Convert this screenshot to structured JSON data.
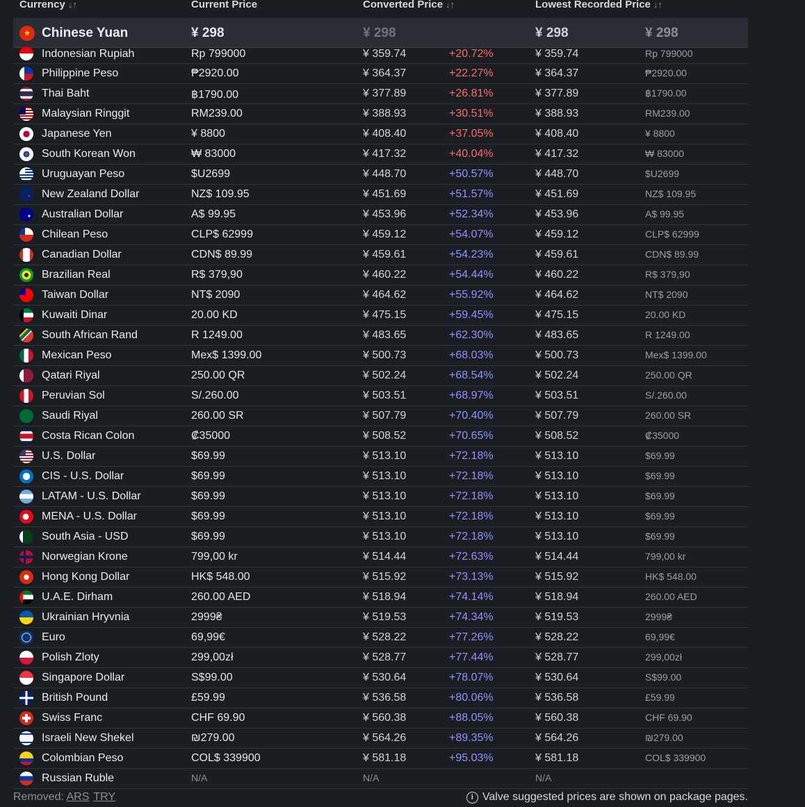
{
  "headers": {
    "currency": "Currency",
    "current_price": "Current Price",
    "converted_price": "Converted Price",
    "lowest_recorded_price": "Lowest Recorded Price",
    "sort_glyph": "↓↑"
  },
  "base": {
    "name": "Chinese Yuan",
    "current": "¥ 298",
    "converted": "¥ 298",
    "lowest": "¥ 298",
    "lowest_local": "¥ 298"
  },
  "rows": [
    {
      "name": "Indonesian Rupiah",
      "current": "Rp 799000",
      "converted": "¥ 359.74",
      "pct": "+20.72%",
      "lowest": "¥ 359.74",
      "lowest_local": "Rp 799000"
    },
    {
      "name": "Philippine Peso",
      "current": "₱2920.00",
      "converted": "¥ 364.37",
      "pct": "+22.27%",
      "lowest": "¥ 364.37",
      "lowest_local": "₱2920.00"
    },
    {
      "name": "Thai Baht",
      "current": "฿1790.00",
      "converted": "¥ 377.89",
      "pct": "+26.81%",
      "lowest": "¥ 377.89",
      "lowest_local": "฿1790.00"
    },
    {
      "name": "Malaysian Ringgit",
      "current": "RM239.00",
      "converted": "¥ 388.93",
      "pct": "+30.51%",
      "lowest": "¥ 388.93",
      "lowest_local": "RM239.00"
    },
    {
      "name": "Japanese Yen",
      "current": "¥ 8800",
      "converted": "¥ 408.40",
      "pct": "+37.05%",
      "lowest": "¥ 408.40",
      "lowest_local": "¥ 8800"
    },
    {
      "name": "South Korean Won",
      "current": "₩ 83000",
      "converted": "¥ 417.32",
      "pct": "+40.04%",
      "lowest": "¥ 417.32",
      "lowest_local": "₩ 83000"
    },
    {
      "name": "Uruguayan Peso",
      "current": "$U2699",
      "converted": "¥ 448.70",
      "pct": "+50.57%",
      "lowest": "¥ 448.70",
      "lowest_local": "$U2699"
    },
    {
      "name": "New Zealand Dollar",
      "current": "NZ$ 109.95",
      "converted": "¥ 451.69",
      "pct": "+51.57%",
      "lowest": "¥ 451.69",
      "lowest_local": "NZ$ 109.95"
    },
    {
      "name": "Australian Dollar",
      "current": "A$ 99.95",
      "converted": "¥ 453.96",
      "pct": "+52.34%",
      "lowest": "¥ 453.96",
      "lowest_local": "A$ 99.95"
    },
    {
      "name": "Chilean Peso",
      "current": "CLP$ 62999",
      "converted": "¥ 459.12",
      "pct": "+54.07%",
      "lowest": "¥ 459.12",
      "lowest_local": "CLP$ 62999"
    },
    {
      "name": "Canadian Dollar",
      "current": "CDN$ 89.99",
      "converted": "¥ 459.61",
      "pct": "+54.23%",
      "lowest": "¥ 459.61",
      "lowest_local": "CDN$ 89.99"
    },
    {
      "name": "Brazilian Real",
      "current": "R$ 379,90",
      "converted": "¥ 460.22",
      "pct": "+54.44%",
      "lowest": "¥ 460.22",
      "lowest_local": "R$ 379,90"
    },
    {
      "name": "Taiwan Dollar",
      "current": "NT$ 2090",
      "converted": "¥ 464.62",
      "pct": "+55.92%",
      "lowest": "¥ 464.62",
      "lowest_local": "NT$ 2090"
    },
    {
      "name": "Kuwaiti Dinar",
      "current": "20.00 KD",
      "converted": "¥ 475.15",
      "pct": "+59.45%",
      "lowest": "¥ 475.15",
      "lowest_local": "20.00 KD"
    },
    {
      "name": "South African Rand",
      "current": "R 1249.00",
      "converted": "¥ 483.65",
      "pct": "+62.30%",
      "lowest": "¥ 483.65",
      "lowest_local": "R 1249.00"
    },
    {
      "name": "Mexican Peso",
      "current": "Mex$ 1399.00",
      "converted": "¥ 500.73",
      "pct": "+68.03%",
      "lowest": "¥ 500.73",
      "lowest_local": "Mex$ 1399.00"
    },
    {
      "name": "Qatari Riyal",
      "current": "250.00 QR",
      "converted": "¥ 502.24",
      "pct": "+68.54%",
      "lowest": "¥ 502.24",
      "lowest_local": "250.00 QR"
    },
    {
      "name": "Peruvian Sol",
      "current": "S/.260.00",
      "converted": "¥ 503.51",
      "pct": "+68.97%",
      "lowest": "¥ 503.51",
      "lowest_local": "S/.260.00"
    },
    {
      "name": "Saudi Riyal",
      "current": "260.00 SR",
      "converted": "¥ 507.79",
      "pct": "+70.40%",
      "lowest": "¥ 507.79",
      "lowest_local": "260.00 SR"
    },
    {
      "name": "Costa Rican Colon",
      "current": "₡35000",
      "converted": "¥ 508.52",
      "pct": "+70.65%",
      "lowest": "¥ 508.52",
      "lowest_local": "₡35000"
    },
    {
      "name": "U.S. Dollar",
      "current": "$69.99",
      "converted": "¥ 513.10",
      "pct": "+72.18%",
      "lowest": "¥ 513.10",
      "lowest_local": "$69.99"
    },
    {
      "name": "CIS - U.S. Dollar",
      "current": "$69.99",
      "converted": "¥ 513.10",
      "pct": "+72.18%",
      "lowest": "¥ 513.10",
      "lowest_local": "$69.99"
    },
    {
      "name": "LATAM - U.S. Dollar",
      "current": "$69.99",
      "converted": "¥ 513.10",
      "pct": "+72.18%",
      "lowest": "¥ 513.10",
      "lowest_local": "$69.99"
    },
    {
      "name": "MENA - U.S. Dollar",
      "current": "$69.99",
      "converted": "¥ 513.10",
      "pct": "+72.18%",
      "lowest": "¥ 513.10",
      "lowest_local": "$69.99"
    },
    {
      "name": "South Asia - USD",
      "current": "$69.99",
      "converted": "¥ 513.10",
      "pct": "+72.18%",
      "lowest": "¥ 513.10",
      "lowest_local": "$69.99"
    },
    {
      "name": "Norwegian Krone",
      "current": "799,00 kr",
      "converted": "¥ 514.44",
      "pct": "+72.63%",
      "lowest": "¥ 514.44",
      "lowest_local": "799,00 kr"
    },
    {
      "name": "Hong Kong Dollar",
      "current": "HK$ 548.00",
      "converted": "¥ 515.92",
      "pct": "+73.13%",
      "lowest": "¥ 515.92",
      "lowest_local": "HK$ 548.00"
    },
    {
      "name": "U.A.E. Dirham",
      "current": "260.00 AED",
      "converted": "¥ 518.94",
      "pct": "+74.14%",
      "lowest": "¥ 518.94",
      "lowest_local": "260.00 AED"
    },
    {
      "name": "Ukrainian Hryvnia",
      "current": "2999₴",
      "converted": "¥ 519.53",
      "pct": "+74.34%",
      "lowest": "¥ 519.53",
      "lowest_local": "2999₴"
    },
    {
      "name": "Euro",
      "current": "69,99€",
      "converted": "¥ 528.22",
      "pct": "+77.26%",
      "lowest": "¥ 528.22",
      "lowest_local": "69,99€"
    },
    {
      "name": "Polish Zloty",
      "current": "299,00zł",
      "converted": "¥ 528.77",
      "pct": "+77.44%",
      "lowest": "¥ 528.77",
      "lowest_local": "299,00zł"
    },
    {
      "name": "Singapore Dollar",
      "current": "S$99.00",
      "converted": "¥ 530.64",
      "pct": "+78.07%",
      "lowest": "¥ 530.64",
      "lowest_local": "S$99.00"
    },
    {
      "name": "British Pound",
      "current": "£59.99",
      "converted": "¥ 536.58",
      "pct": "+80.06%",
      "lowest": "¥ 536.58",
      "lowest_local": "£59.99"
    },
    {
      "name": "Swiss Franc",
      "current": "CHF 69.90",
      "converted": "¥ 560.38",
      "pct": "+88.05%",
      "lowest": "¥ 560.38",
      "lowest_local": "CHF 69.90"
    },
    {
      "name": "Israeli New Shekel",
      "current": "₪279.00",
      "converted": "¥ 564.26",
      "pct": "+89.35%",
      "lowest": "¥ 564.26",
      "lowest_local": "₪279.00"
    },
    {
      "name": "Colombian Peso",
      "current": "COL$ 339900",
      "converted": "¥ 581.18",
      "pct": "+95.03%",
      "lowest": "¥ 581.18",
      "lowest_local": "COL$ 339900"
    },
    {
      "name": "Russian Ruble",
      "current": "N/A",
      "converted": "N/A",
      "pct": "",
      "lowest": "N/A",
      "lowest_local": ""
    }
  ],
  "footer": {
    "removed_label": "Removed:",
    "removed_links": [
      "ARS",
      "TRY"
    ],
    "note": "Valve suggested prices are shown on package pages."
  },
  "colors": {
    "pct_red": "#ff6b6b",
    "pct_blue": "#8f94ff"
  }
}
